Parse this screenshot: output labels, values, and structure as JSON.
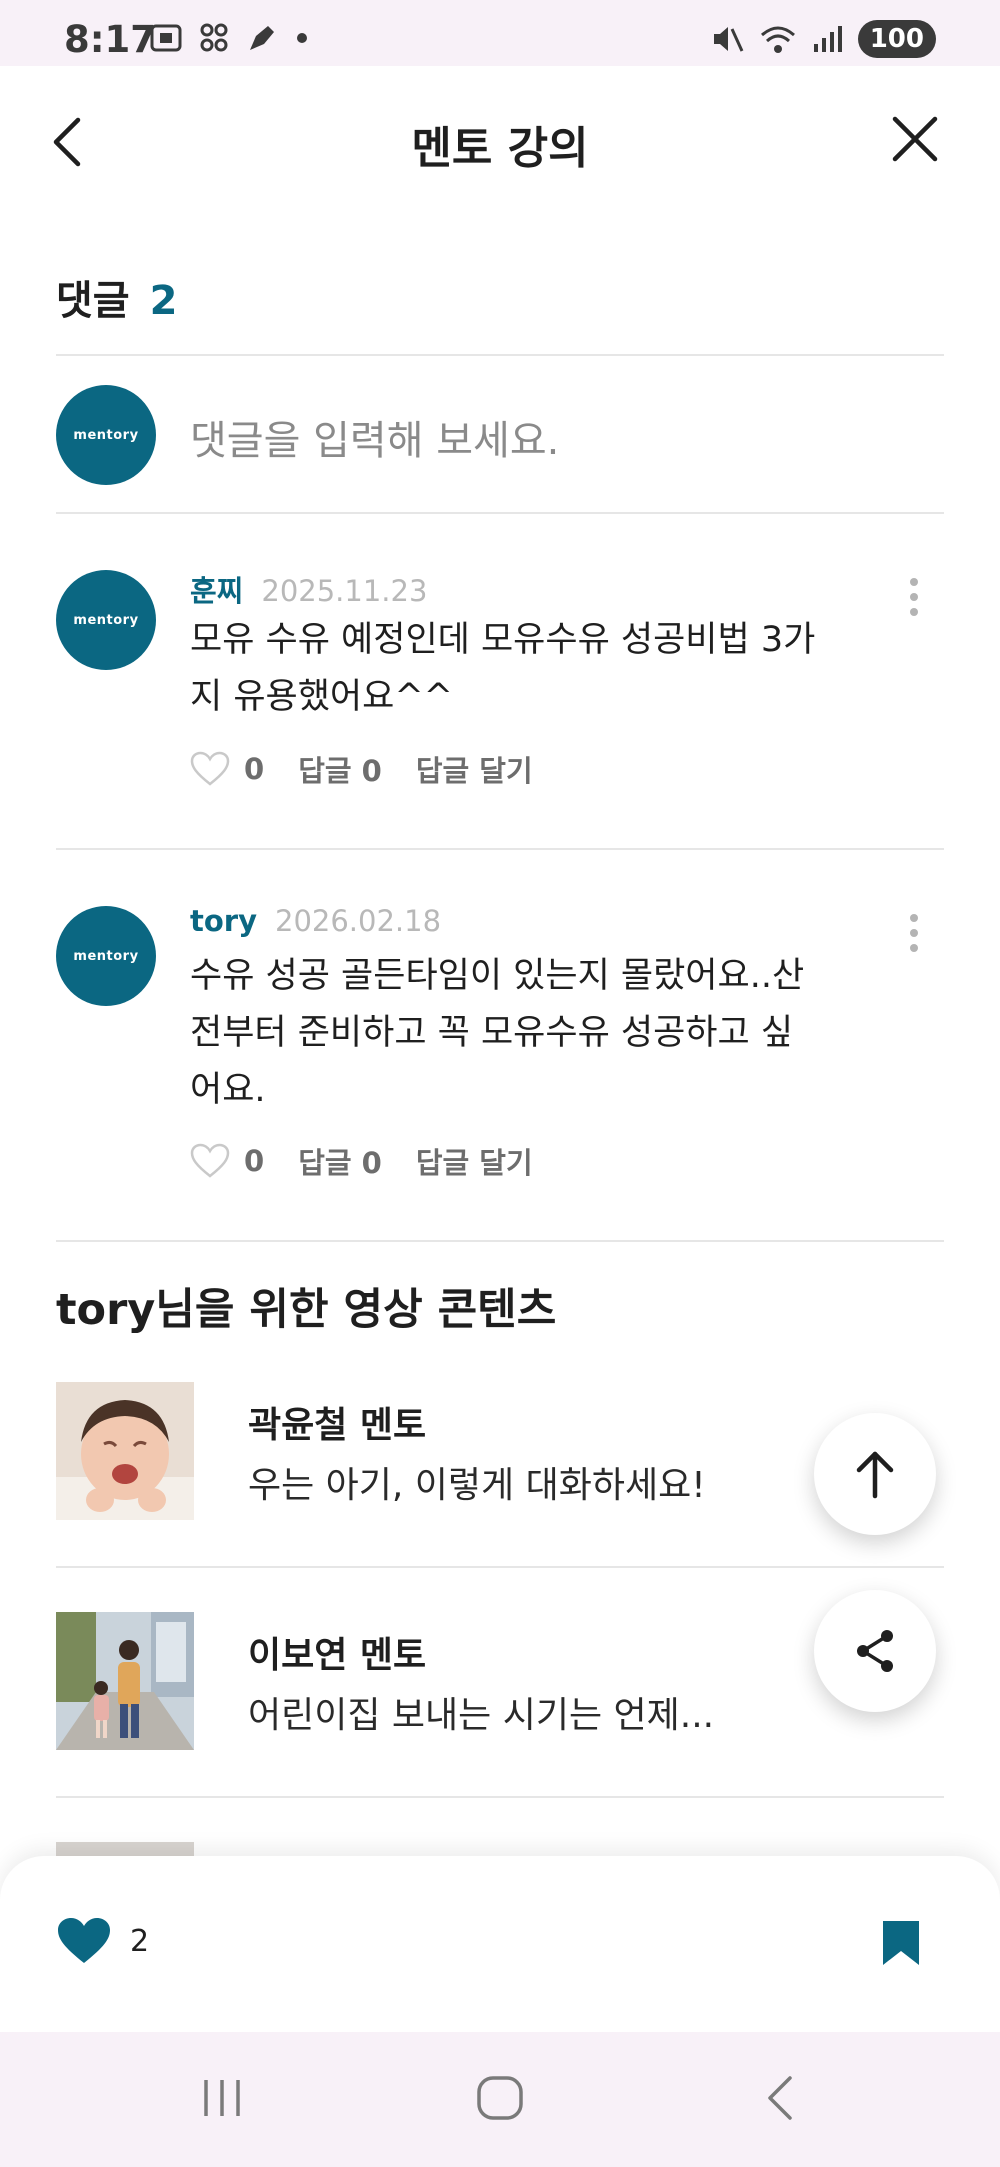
{
  "status_bar": {
    "time": "8:17",
    "battery": "100",
    "icons_left": [
      "screenshot-icon",
      "qr-icon",
      "pen-icon",
      "dot-icon"
    ],
    "icons_right": [
      "mute-icon",
      "wifi-icon",
      "signal-icon",
      "battery-icon"
    ]
  },
  "header": {
    "title": "멘토 강의",
    "back_icon": "chevron-left-icon",
    "close_icon": "close-icon"
  },
  "comments": {
    "label": "댓글",
    "count": "2",
    "input_placeholder": "댓글을 입력해 보세요.",
    "avatar_text": "mentory",
    "items": [
      {
        "author": "훈찌",
        "date": "2025.11.23",
        "lines": [
          "모유 수유 예정인데 모유수유 성공비법 3가",
          "지 유용했어요^^"
        ],
        "likes": "0",
        "replies_label": "답글 0",
        "reply_action": "답글 달기"
      },
      {
        "author": "tory",
        "date": "2026.02.18",
        "lines": [
          "수유 성공 골든타임이 있는지 몰랐어요..산",
          "전부터 준비하고 꼭 모유수유 성공하고 싶",
          "어요."
        ],
        "likes": "0",
        "replies_label": "답글 0",
        "reply_action": "답글 달기"
      }
    ]
  },
  "videos": {
    "section_title": "tory님을 위한 영상 콘텐츠",
    "items": [
      {
        "mentor": "곽윤철 멘토",
        "title": "우는 아기, 이렇게 대화하세요!"
      },
      {
        "mentor": "이보연 멘토",
        "title": "어린이집 보내는 시기는 언제..."
      }
    ]
  },
  "fabs": {
    "scroll_top_icon": "arrow-up-icon",
    "share_icon": "share-icon"
  },
  "bottom_bar": {
    "like_count": "2",
    "like_icon": "heart-icon",
    "bookmark_icon": "bookmark-icon"
  },
  "colors": {
    "brand": "#0b6782",
    "status_bg": "#f8f1f8"
  },
  "navbar": {
    "icons": [
      "recent-apps-icon",
      "home-icon",
      "back-icon"
    ]
  }
}
